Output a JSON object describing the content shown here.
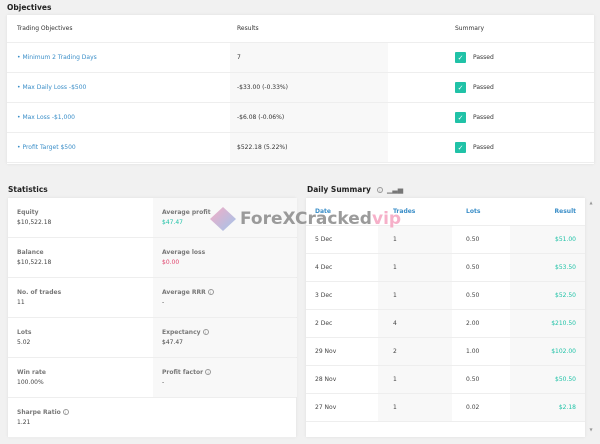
{
  "objectives": {
    "title": "Objectives",
    "headers": [
      "Trading Objectives",
      "Results",
      "Summary"
    ],
    "rows": [
      {
        "objective": "• Minimum 2 Trading Days",
        "result": "7",
        "summary": "Passed"
      },
      {
        "objective": "• Max Daily Loss -$500",
        "result": "-$33.00 (-0.33%)",
        "summary": "Passed"
      },
      {
        "objective": "• Max Loss -$1,000",
        "result": "-$6.08 (-0.06%)",
        "summary": "Passed"
      },
      {
        "objective": "• Profit Target $500",
        "result": "$522.18 (5.22%)",
        "summary": "Passed"
      }
    ]
  },
  "statistics": {
    "title": "Statistics",
    "rows": [
      [
        {
          "label": "Equity",
          "value": "$10,522.18"
        },
        {
          "label": "Average profit",
          "value": "$47.47",
          "color": "#20c2a7"
        }
      ],
      [
        {
          "label": "Balance",
          "value": "$10,522.18"
        },
        {
          "label": "Average loss",
          "value": "$0.00",
          "color": "#e0456e"
        }
      ],
      [
        {
          "label": "No. of trades",
          "value": "11"
        },
        {
          "label": "Average RRR",
          "value": "-",
          "info": true
        }
      ],
      [
        {
          "label": "Lots",
          "value": "5.02"
        },
        {
          "label": "Expectancy",
          "value": "$47.47",
          "info": true
        }
      ],
      [
        {
          "label": "Win rate",
          "value": "100.00%"
        },
        {
          "label": "Profit factor",
          "value": "-",
          "info": true
        }
      ],
      [
        {
          "label": "Sharpe Ratio",
          "value": "1.21",
          "info": true
        }
      ]
    ]
  },
  "daily_summary": {
    "title": "Daily Summary",
    "headers": [
      "Date",
      "Trades",
      "Lots",
      "Result"
    ],
    "rows": [
      [
        "5 Dec",
        "1",
        "0.50",
        "$51.00"
      ],
      [
        "4 Dec",
        "1",
        "0.50",
        "$53.50"
      ],
      [
        "3 Dec",
        "1",
        "0.50",
        "$52.50"
      ],
      [
        "2 Dec",
        "4",
        "2.00",
        "$210.50"
      ],
      [
        "29 Nov",
        "2",
        "1.00",
        "$102.00"
      ],
      [
        "28 Nov",
        "1",
        "0.50",
        "$50.50"
      ],
      [
        "27 Nov",
        "1",
        "0.02",
        "$2.18"
      ]
    ]
  },
  "watermark": {
    "text": "ForeXCracked",
    "suffix": "vip"
  },
  "colors": {
    "accent": "#3a8ec8",
    "positive": "#20c2a7",
    "negative": "#e0456e"
  },
  "icons": {
    "check": "check-icon",
    "info": "info-icon",
    "chart": "bar-chart-icon"
  }
}
